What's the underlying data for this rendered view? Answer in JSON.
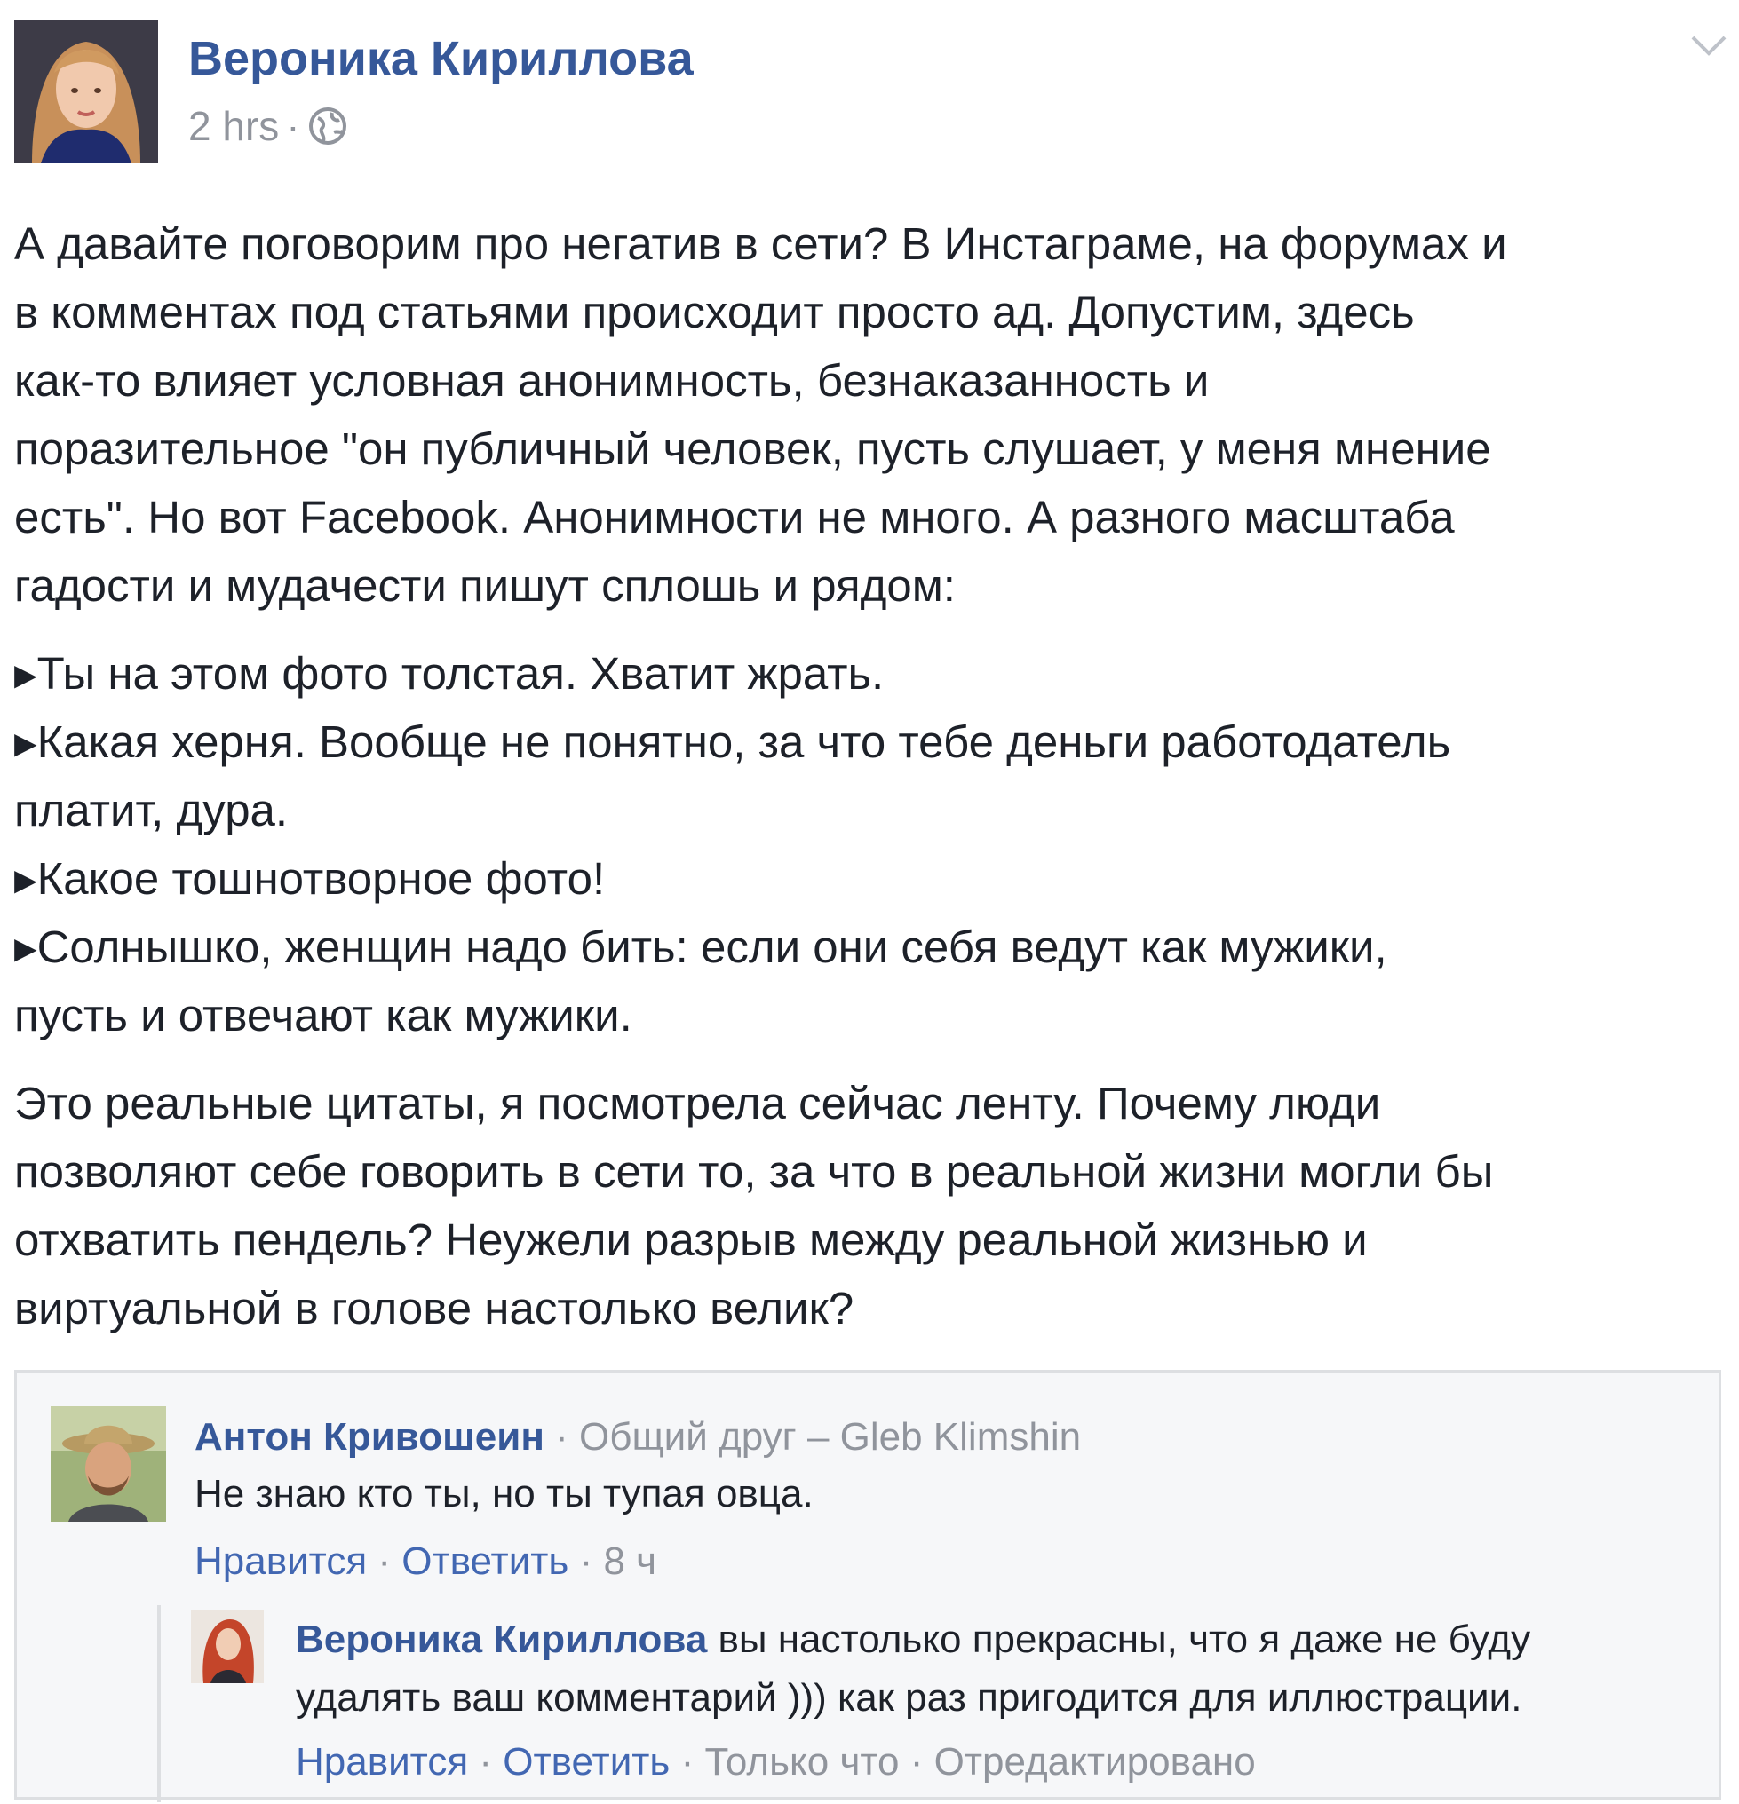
{
  "post": {
    "author_name": "Вероника Кириллова",
    "timestamp": "2 hrs",
    "meta_separator": "·",
    "privacy_icon": "globe-icon",
    "menu_icon": "chevron-down-icon",
    "paragraph1": [
      "А давайте поговорим про негатив в сети? В Инстаграме, на форумах и",
      "в комментах под статьями происходит просто ад. Допустим, здесь",
      "как-то влияет условная анонимность, безнаказанность и",
      "поразительное \"он публичный человек, пусть слушает, у меня мнение",
      "есть\". Но вот Facebook. Анонимности не много. А разного масштаба",
      "гадости и мудачести пишут сплошь и рядом:"
    ],
    "quotes": [
      "▸Ты на этом фото толстая. Хватит жрать.",
      "▸Какая херня. Вообще не понятно, за что тебе деньги работодатель",
      "платит, дура.",
      "▸Какое тошнотворное фото!",
      "▸Солнышко, женщин надо бить: если они себя ведут как мужики,",
      "пусть и отвечают как мужики."
    ],
    "paragraph3": [
      "Это реальные цитаты, я посмотрела сейчас ленту. Почему люди",
      "позволяют себе говорить в сети то, за что в реальной жизни могли бы",
      "отхватить пендель? Неужели разрыв между реальной жизнью и",
      "виртуальной в голове настолько велик?"
    ]
  },
  "comment": {
    "author": "Антон Кривошеин",
    "separator": " · ",
    "relation": "Общий друг – Gleb Klimshin",
    "text": "Не знаю кто ты, но ты тупая овца.",
    "like": "Нравится",
    "reply": "Ответить",
    "time": "8 ч"
  },
  "reply": {
    "author": "Вероника Кириллова",
    "text": " вы настолько прекрасны, что я даже не буду удалять ваш комментарий ))) как раз пригодится для иллюстрации.",
    "like": "Нравится",
    "reply": "Ответить",
    "time": "Только что",
    "edited": "Отредактировано"
  },
  "colors": {
    "name_blue": "#365899",
    "link_blue": "#4267b2",
    "muted_gray": "#90949c",
    "text": "#1d2129",
    "comment_bg": "#f6f7f9",
    "border": "#dddfe2"
  }
}
